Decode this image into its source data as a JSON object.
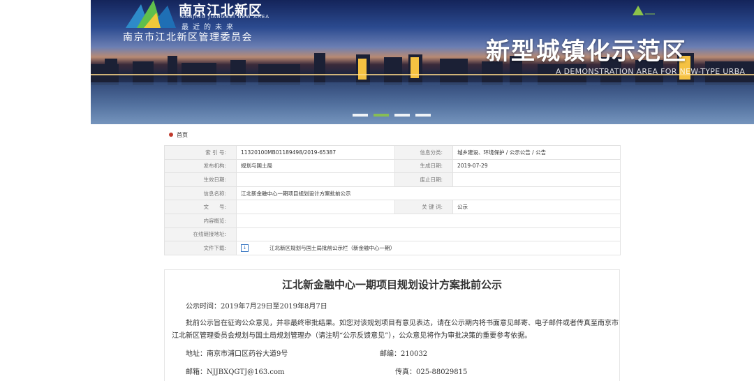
{
  "banner": {
    "logo_title": "南京江北新区",
    "logo_en": "NANJING JIANGBEI NEW AREA",
    "logo_slogan": "最近的未来",
    "org_name": "南京市江北新区管理委员会",
    "heading": "新型城镇化示范区",
    "subheading": "A DEMONSTRATION AREA FOR NEW-TYPE URBA",
    "slides": 4,
    "active_slide": 2,
    "colors": {
      "accent": "#8bc34a",
      "sky": "#2b4a8f"
    }
  },
  "breadcrumb": {
    "home": "首页"
  },
  "info": {
    "index_no_label": "索 引 号:",
    "index_no": "11320100MB01189498/2019-65387",
    "category_label": "信息分类:",
    "category": "城乡建设、环境保护 / 公示公告 / 公告",
    "publisher_label": "发布机构:",
    "publisher": "规划与国土局",
    "gen_date_label": "生成日期:",
    "gen_date": "2019-07-29",
    "effective_label": "生效日期:",
    "effective": "",
    "expiry_label": "废止日期:",
    "expiry": "",
    "name_label": "信息名称:",
    "name": "江北新金融中心一期项目规划设计方案批前公示",
    "doc_no_label": "文　　号:",
    "doc_no": "",
    "keywords_label": "关 键 词:",
    "keywords": "公示",
    "summary_label": "内容概览:",
    "summary": "",
    "link_label": "在线链接地址:",
    "link": "",
    "download_label": "文件下载:",
    "download_file": "江北新区规划与国土局批前公示栏（新金融中心一期）"
  },
  "notice": {
    "title": "江北新金融中心一期项目规划设计方案批前公示",
    "time": "公示时间：2019年7月29日至2019年8月7日",
    "body": "批前公示旨在征询公众意见，并非最终审批结果。如您对该规划项目有意见表达，请在公示期内将书面意见邮寄、电子邮件或者传真至南京市江北新区管理委员会规划与国土局规划管理办（请注明“公示反馈意见”），公众意见将作为审批决策的重要参考依据。",
    "address": "地址：南京市浦口区药谷大道9号",
    "zip": "邮编：210032",
    "email": "邮箱：NJJBXQGTJ@163.com",
    "fax": "传真：025-88029815"
  }
}
